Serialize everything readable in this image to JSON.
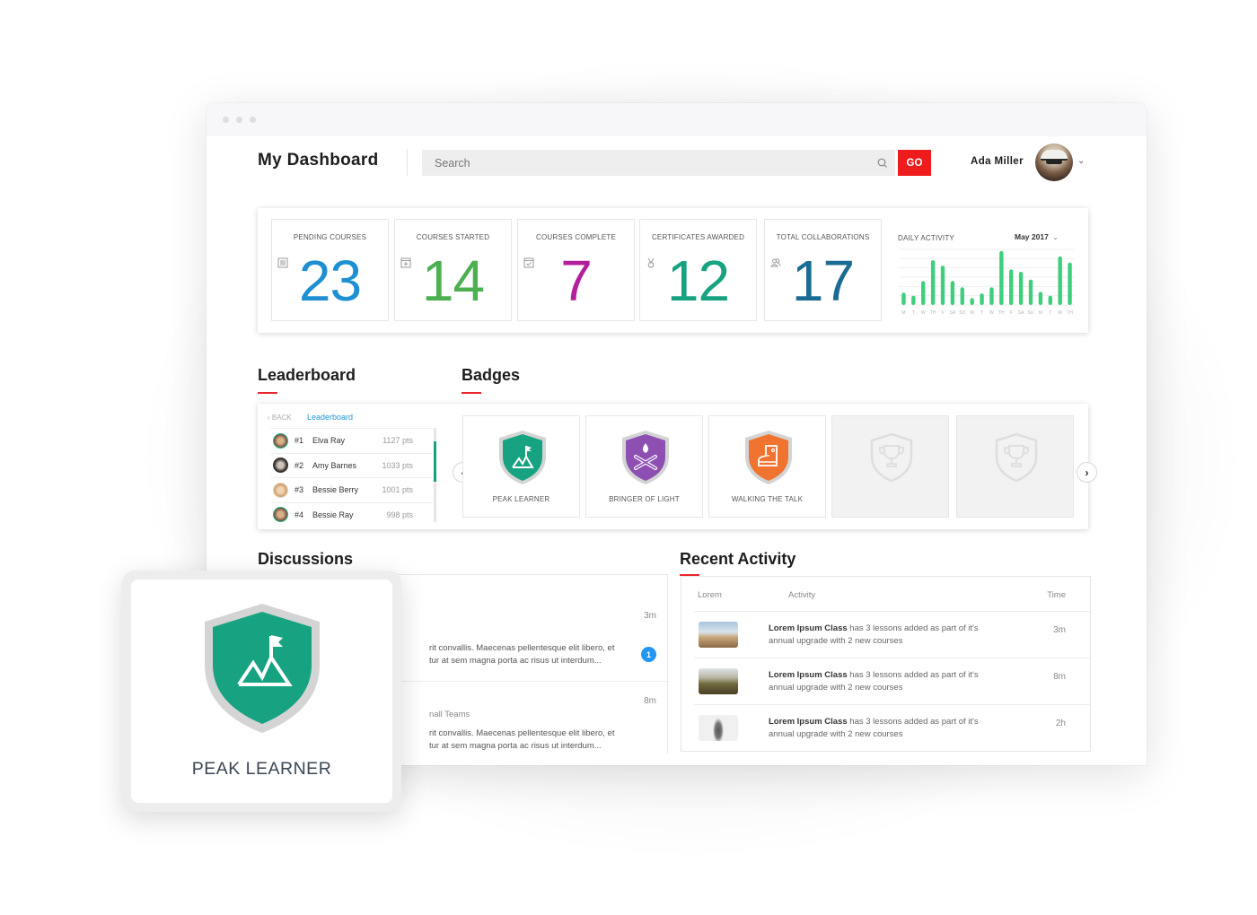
{
  "window": {
    "title": "My Dashboard"
  },
  "header": {
    "title": "My Dashboard",
    "search_placeholder": "Search",
    "go_label": "GO",
    "user_name": "Ada Miller"
  },
  "stats": [
    {
      "label": "PENDING COURSES",
      "value": "23",
      "icon": "list-icon",
      "color": "#1e90d2"
    },
    {
      "label": "COURSES STARTED",
      "value": "14",
      "icon": "calendar-plus-icon",
      "color": "#4cb050"
    },
    {
      "label": "COURSES COMPLETE",
      "value": "7",
      "icon": "calendar-check-icon",
      "color": "#b21f9c"
    },
    {
      "label": "CERTIFICATES AWARDED",
      "value": "12",
      "icon": "medal-icon",
      "color": "#17a382"
    },
    {
      "label": "TOTAL COLLABORATIONS",
      "value": "17",
      "icon": "users-icon",
      "color": "#1a6c94"
    }
  ],
  "daily_activity": {
    "title": "DAILY ACTIVITY",
    "month": "May 2017"
  },
  "chart_data": {
    "type": "bar",
    "title": "DAILY ACTIVITY",
    "categories": [
      "M",
      "T",
      "W",
      "TH",
      "F",
      "SA",
      "SU",
      "M",
      "T",
      "W",
      "TH",
      "F",
      "SA",
      "SU",
      "M",
      "T",
      "W",
      "TH"
    ],
    "values": [
      1.6,
      1.2,
      3.1,
      5.8,
      5.1,
      3.1,
      2.3,
      0.9,
      1.5,
      2.3,
      7.0,
      4.6,
      4.3,
      3.3,
      1.7,
      1.2,
      6.3,
      5.5
    ],
    "ylim": [
      0,
      7.2
    ],
    "grid": true,
    "xlabel": "",
    "ylabel": "",
    "color": "#3ecf7d"
  },
  "leaderboard": {
    "title": "Leaderboard",
    "back_label": "BACK",
    "tab_label": "Leaderboard",
    "rows": [
      {
        "rank": "#1",
        "name": "Elva Ray",
        "points": "1127 pts"
      },
      {
        "rank": "#2",
        "name": "Amy Barnes",
        "points": "1033 pts"
      },
      {
        "rank": "#3",
        "name": "Bessie Berry",
        "points": "1001 pts"
      },
      {
        "rank": "#4",
        "name": "Bessie Ray",
        "points": "998 pts"
      }
    ]
  },
  "badges": {
    "title": "Badges",
    "items": [
      {
        "label": "PEAK LEARNER",
        "color": "#17a382",
        "icon": "mountain-flag-icon",
        "locked": false
      },
      {
        "label": "BRINGER OF LIGHT",
        "color": "#8e4fb3",
        "icon": "campfire-icon",
        "locked": false
      },
      {
        "label": "WALKING THE TALK",
        "color": "#f07430",
        "icon": "sneaker-icon",
        "locked": false
      },
      {
        "label": "",
        "color": "#dedede",
        "icon": "trophy-icon",
        "locked": true
      },
      {
        "label": "",
        "color": "#dedede",
        "icon": "trophy-icon",
        "locked": true
      }
    ]
  },
  "discussions": {
    "title": "Discussions",
    "items": [
      {
        "time": "3m",
        "subtitle": "",
        "text_line1": "rit convallis. Maecenas pellentesque elit libero, et",
        "text_line2": "tur at sem magna porta ac risus ut interdum...",
        "unread": "1"
      },
      {
        "time": "8m",
        "subtitle": "nall Teams",
        "text_line1": "rit convallis. Maecenas pellentesque elit libero, et",
        "text_line2": "tur at sem magna porta ac risus ut interdum...",
        "unread": ""
      }
    ]
  },
  "recent_activity": {
    "title": "Recent Activity",
    "columns": [
      "Lorem",
      "Activity",
      "Time"
    ],
    "rows": [
      {
        "bold": "Lorem Ipsum Class",
        "text": " has 3 lessons added as part of it's annual upgrade with 2 new courses",
        "time": "3m"
      },
      {
        "bold": "Lorem Ipsum Class",
        "text": " has 3 lessons added as part of it's annual upgrade with 2 new courses",
        "time": "8m"
      },
      {
        "bold": "Lorem Ipsum Class",
        "text": " has 3 lessons added as part of it's annual upgrade with 2 new courses",
        "time": "2h"
      }
    ]
  },
  "featured_badge": {
    "label": "PEAK LEARNER",
    "color": "#17a382"
  }
}
